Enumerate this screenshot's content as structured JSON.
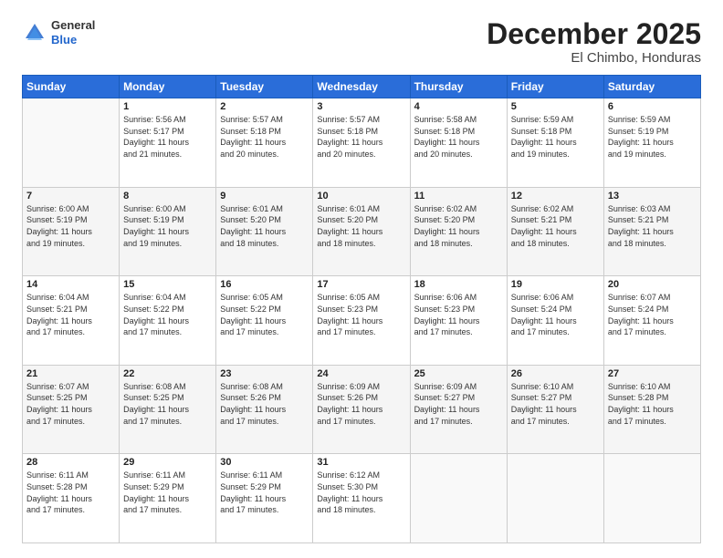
{
  "header": {
    "logo_general": "General",
    "logo_blue": "Blue",
    "month": "December 2025",
    "location": "El Chimbo, Honduras"
  },
  "calendar": {
    "days_of_week": [
      "Sunday",
      "Monday",
      "Tuesday",
      "Wednesday",
      "Thursday",
      "Friday",
      "Saturday"
    ],
    "weeks": [
      [
        {
          "day": "",
          "info": ""
        },
        {
          "day": "1",
          "info": "Sunrise: 5:56 AM\nSunset: 5:17 PM\nDaylight: 11 hours\nand 21 minutes."
        },
        {
          "day": "2",
          "info": "Sunrise: 5:57 AM\nSunset: 5:18 PM\nDaylight: 11 hours\nand 20 minutes."
        },
        {
          "day": "3",
          "info": "Sunrise: 5:57 AM\nSunset: 5:18 PM\nDaylight: 11 hours\nand 20 minutes."
        },
        {
          "day": "4",
          "info": "Sunrise: 5:58 AM\nSunset: 5:18 PM\nDaylight: 11 hours\nand 20 minutes."
        },
        {
          "day": "5",
          "info": "Sunrise: 5:59 AM\nSunset: 5:18 PM\nDaylight: 11 hours\nand 19 minutes."
        },
        {
          "day": "6",
          "info": "Sunrise: 5:59 AM\nSunset: 5:19 PM\nDaylight: 11 hours\nand 19 minutes."
        }
      ],
      [
        {
          "day": "7",
          "info": "Sunrise: 6:00 AM\nSunset: 5:19 PM\nDaylight: 11 hours\nand 19 minutes."
        },
        {
          "day": "8",
          "info": "Sunrise: 6:00 AM\nSunset: 5:19 PM\nDaylight: 11 hours\nand 19 minutes."
        },
        {
          "day": "9",
          "info": "Sunrise: 6:01 AM\nSunset: 5:20 PM\nDaylight: 11 hours\nand 18 minutes."
        },
        {
          "day": "10",
          "info": "Sunrise: 6:01 AM\nSunset: 5:20 PM\nDaylight: 11 hours\nand 18 minutes."
        },
        {
          "day": "11",
          "info": "Sunrise: 6:02 AM\nSunset: 5:20 PM\nDaylight: 11 hours\nand 18 minutes."
        },
        {
          "day": "12",
          "info": "Sunrise: 6:02 AM\nSunset: 5:21 PM\nDaylight: 11 hours\nand 18 minutes."
        },
        {
          "day": "13",
          "info": "Sunrise: 6:03 AM\nSunset: 5:21 PM\nDaylight: 11 hours\nand 18 minutes."
        }
      ],
      [
        {
          "day": "14",
          "info": "Sunrise: 6:04 AM\nSunset: 5:21 PM\nDaylight: 11 hours\nand 17 minutes."
        },
        {
          "day": "15",
          "info": "Sunrise: 6:04 AM\nSunset: 5:22 PM\nDaylight: 11 hours\nand 17 minutes."
        },
        {
          "day": "16",
          "info": "Sunrise: 6:05 AM\nSunset: 5:22 PM\nDaylight: 11 hours\nand 17 minutes."
        },
        {
          "day": "17",
          "info": "Sunrise: 6:05 AM\nSunset: 5:23 PM\nDaylight: 11 hours\nand 17 minutes."
        },
        {
          "day": "18",
          "info": "Sunrise: 6:06 AM\nSunset: 5:23 PM\nDaylight: 11 hours\nand 17 minutes."
        },
        {
          "day": "19",
          "info": "Sunrise: 6:06 AM\nSunset: 5:24 PM\nDaylight: 11 hours\nand 17 minutes."
        },
        {
          "day": "20",
          "info": "Sunrise: 6:07 AM\nSunset: 5:24 PM\nDaylight: 11 hours\nand 17 minutes."
        }
      ],
      [
        {
          "day": "21",
          "info": "Sunrise: 6:07 AM\nSunset: 5:25 PM\nDaylight: 11 hours\nand 17 minutes."
        },
        {
          "day": "22",
          "info": "Sunrise: 6:08 AM\nSunset: 5:25 PM\nDaylight: 11 hours\nand 17 minutes."
        },
        {
          "day": "23",
          "info": "Sunrise: 6:08 AM\nSunset: 5:26 PM\nDaylight: 11 hours\nand 17 minutes."
        },
        {
          "day": "24",
          "info": "Sunrise: 6:09 AM\nSunset: 5:26 PM\nDaylight: 11 hours\nand 17 minutes."
        },
        {
          "day": "25",
          "info": "Sunrise: 6:09 AM\nSunset: 5:27 PM\nDaylight: 11 hours\nand 17 minutes."
        },
        {
          "day": "26",
          "info": "Sunrise: 6:10 AM\nSunset: 5:27 PM\nDaylight: 11 hours\nand 17 minutes."
        },
        {
          "day": "27",
          "info": "Sunrise: 6:10 AM\nSunset: 5:28 PM\nDaylight: 11 hours\nand 17 minutes."
        }
      ],
      [
        {
          "day": "28",
          "info": "Sunrise: 6:11 AM\nSunset: 5:28 PM\nDaylight: 11 hours\nand 17 minutes."
        },
        {
          "day": "29",
          "info": "Sunrise: 6:11 AM\nSunset: 5:29 PM\nDaylight: 11 hours\nand 17 minutes."
        },
        {
          "day": "30",
          "info": "Sunrise: 6:11 AM\nSunset: 5:29 PM\nDaylight: 11 hours\nand 17 minutes."
        },
        {
          "day": "31",
          "info": "Sunrise: 6:12 AM\nSunset: 5:30 PM\nDaylight: 11 hours\nand 18 minutes."
        },
        {
          "day": "",
          "info": ""
        },
        {
          "day": "",
          "info": ""
        },
        {
          "day": "",
          "info": ""
        }
      ]
    ]
  }
}
